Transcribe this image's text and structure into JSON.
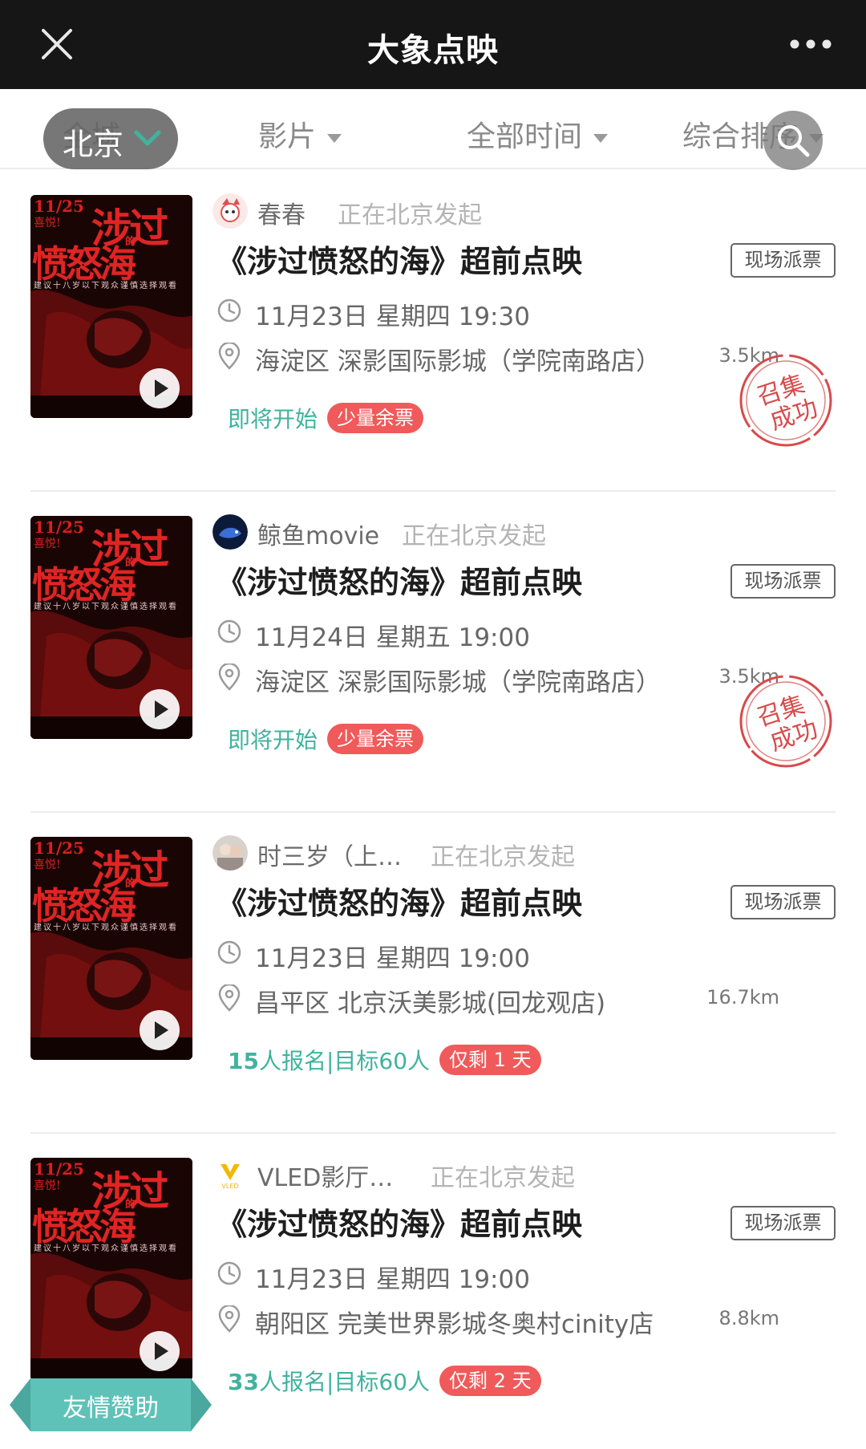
{
  "app": {
    "title": "大象点映"
  },
  "icons": {
    "close": "close-icon",
    "more": "more-dots-icon",
    "search": "search-icon",
    "clock": "clock-icon",
    "location": "location-pin-icon",
    "play": "play-icon"
  },
  "filters": {
    "city_bg": "全城",
    "city_selected": "北京",
    "film": "影片",
    "time": "全部时间",
    "sort": "综合排序"
  },
  "colors": {
    "accent_green": "#3fb39e",
    "tag_red": "#f05a5a",
    "stamp_red": "#d84a4a",
    "header_bg": "#161616"
  },
  "poster": {
    "date": "11/25",
    "sub": "喜悦!",
    "title_line1": "涉过",
    "title_line2": "愤怒海",
    "mini": "的",
    "tagline": "建议十八岁以下观众谨慎选择观看"
  },
  "cards": [
    {
      "organizer": "春春",
      "status": "正在北京发起",
      "title": "《涉过愤怒的海》超前点映",
      "badge": "现场派票",
      "datetime": "11月23日 星期四 19:30",
      "location": "海淀区 深影国际影城（学院南路店）",
      "distance": "3.5km",
      "state": "即将开始",
      "tag": "少量余票",
      "stamp": [
        "召集",
        "成功"
      ]
    },
    {
      "organizer": "鲸鱼movie",
      "status": "正在北京发起",
      "title": "《涉过愤怒的海》超前点映",
      "badge": "现场派票",
      "datetime": "11月24日 星期五 19:00",
      "location": "海淀区 深影国际影城（学院南路店）",
      "distance": "3.5km",
      "state": "即将开始",
      "tag": "少量余票",
      "stamp": [
        "召集",
        "成功"
      ]
    },
    {
      "organizer": "时三岁（上…",
      "status": "正在北京发起",
      "title": "《涉过愤怒的海》超前点映",
      "badge": "现场派票",
      "datetime": "11月23日 星期四 19:00",
      "location": "昌平区 北京沃美影城(回龙观店)",
      "distance": "16.7km",
      "count": "15",
      "count_text": "人报名|目标60人",
      "tag": "仅剩 1 天"
    },
    {
      "organizer": "VLED影厅…",
      "status": "正在北京发起",
      "title": "《涉过愤怒的海》超前点映",
      "badge": "现场派票",
      "datetime": "11月23日 星期四 19:00",
      "location": "朝阳区 完美世界影城冬奥村cinity店",
      "distance": "8.8km",
      "count": "33",
      "count_text": "人报名|目标60人",
      "tag": "仅剩 2 天"
    }
  ],
  "sponsor": {
    "label": "友情赞助"
  }
}
